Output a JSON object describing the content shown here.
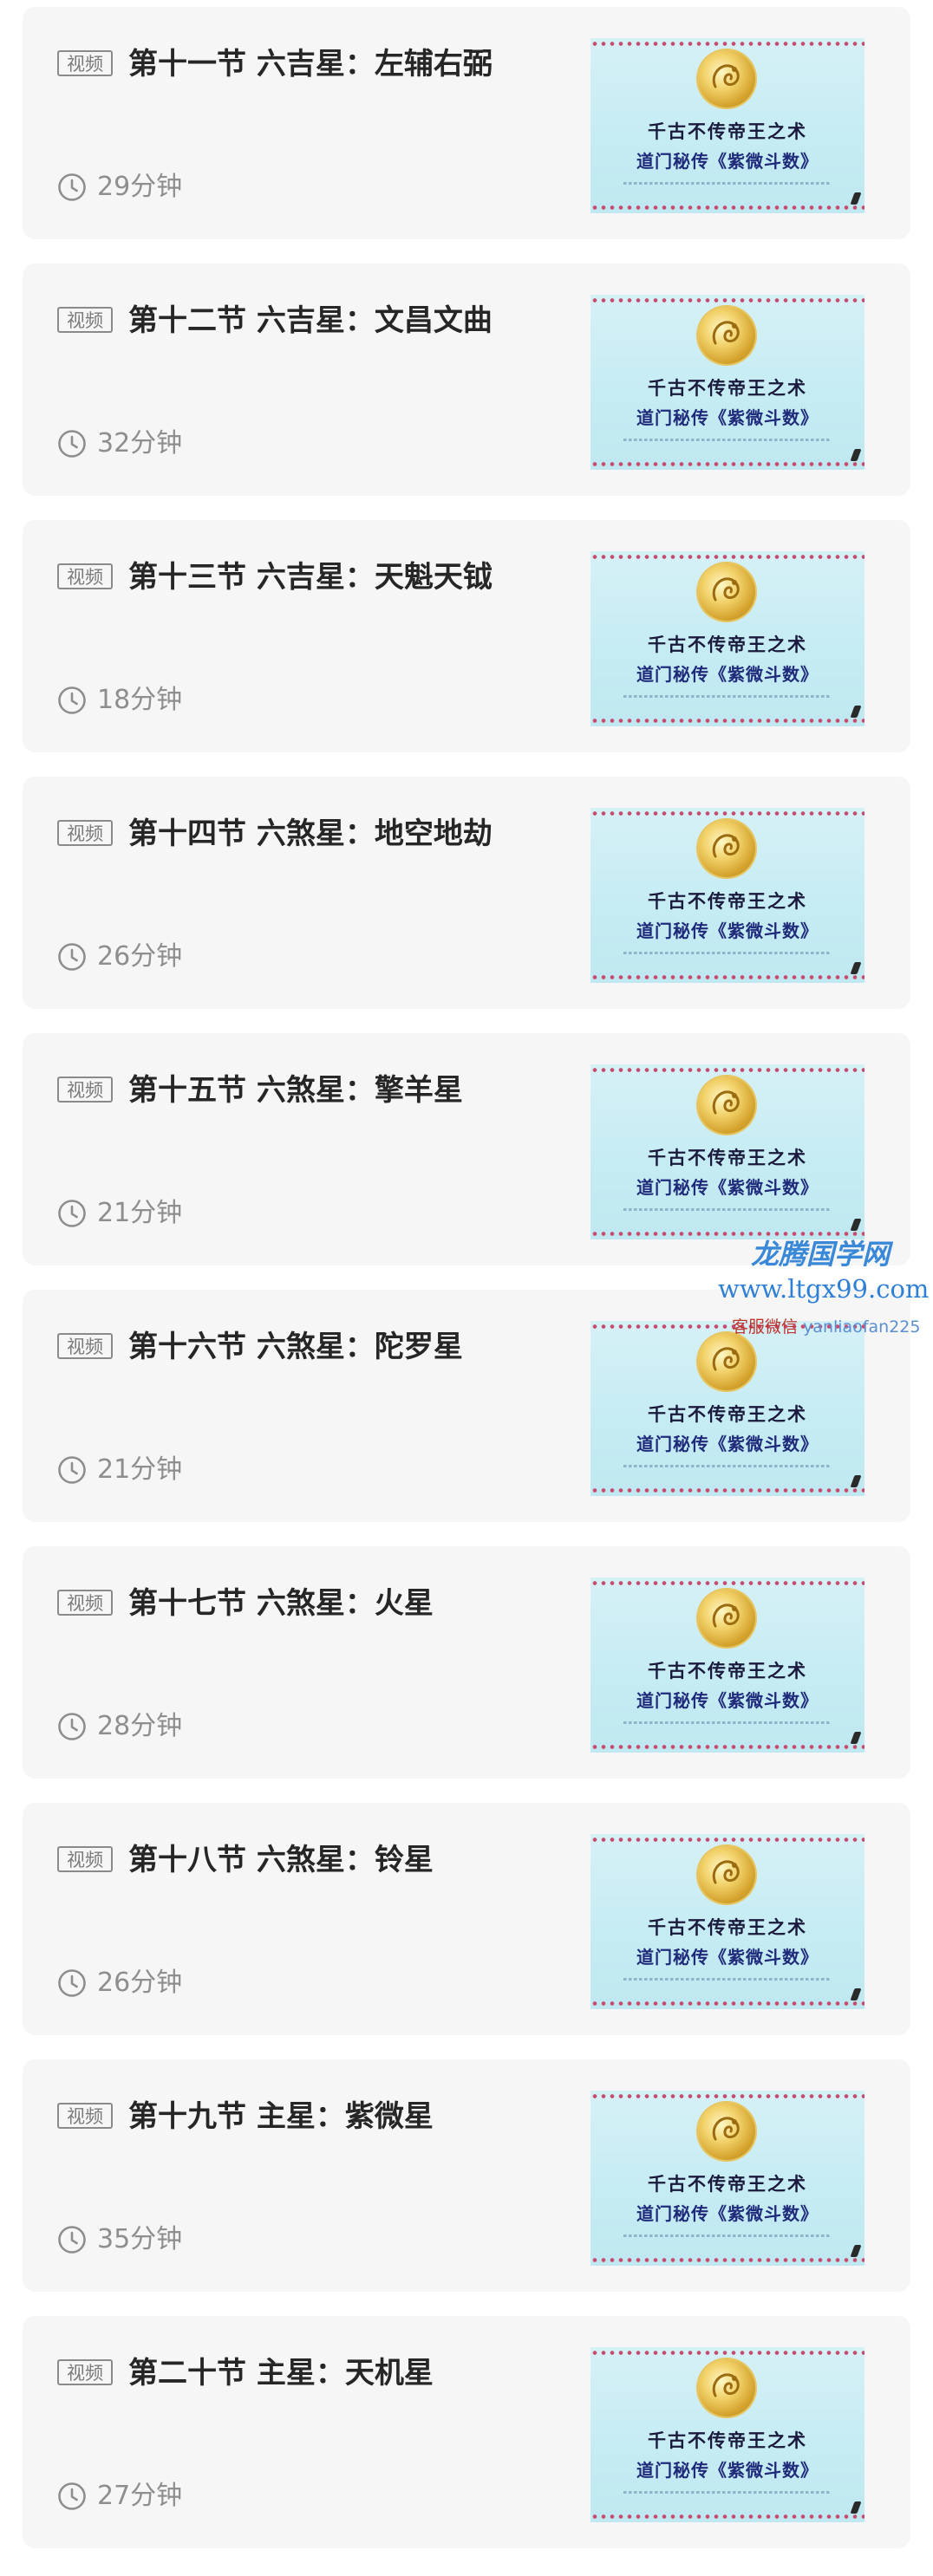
{
  "badge_label": "视频",
  "lessons": [
    {
      "title": "第十一节 六吉星：左辅右弼",
      "duration": "29分钟"
    },
    {
      "title": "第十二节 六吉星：文昌文曲",
      "duration": "32分钟"
    },
    {
      "title": "第十三节 六吉星：天魁天钺",
      "duration": "18分钟"
    },
    {
      "title": "第十四节 六煞星：地空地劫",
      "duration": "26分钟"
    },
    {
      "title": "第十五节 六煞星：擎羊星",
      "duration": "21分钟"
    },
    {
      "title": "第十六节 六煞星：陀罗星",
      "duration": "21分钟"
    },
    {
      "title": "第十七节 六煞星：火星",
      "duration": "28分钟"
    },
    {
      "title": "第十八节 六煞星：铃星",
      "duration": "26分钟"
    },
    {
      "title": "第十九节 主星：紫微星",
      "duration": "35分钟"
    },
    {
      "title": "第二十节 主星：天机星",
      "duration": "27分钟"
    }
  ],
  "thumbnail": {
    "line1": "千古不传帝王之术",
    "line2": "道门秘传《紫微斗数》"
  },
  "watermark": {
    "title": "龙腾国学网",
    "url": "www.ltgx99.com",
    "contact_label": "客服微信",
    "contact_id": "yanliaofan225"
  },
  "colors": {
    "card_bg": "#f6f6f6",
    "title_text": "#262626",
    "muted_text": "#8e8e8e",
    "thumbnail_bg": "#c6ecf3",
    "watermark_blue": "#2e7fd6"
  },
  "icons": {
    "duration": "clock-icon",
    "thumbnail_emblem": "dragon-medallion-icon"
  }
}
